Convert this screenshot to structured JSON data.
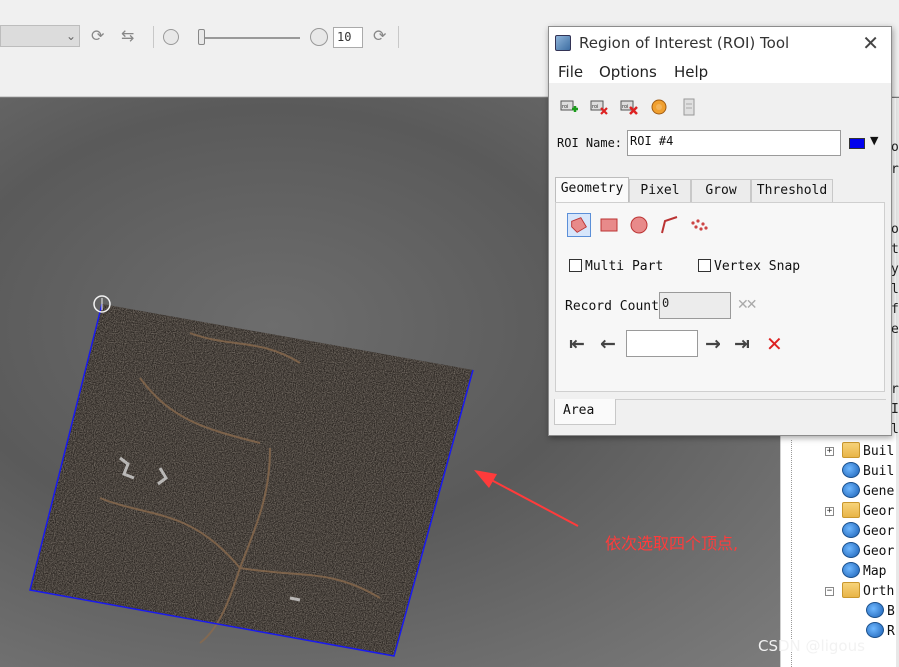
{
  "toolbar": {
    "slider_value": "10",
    "icons": [
      "refresh-icon",
      "stretch-icon",
      "brightness-icon",
      "refresh-icon"
    ]
  },
  "dialog": {
    "title": "Region of Interest (ROI) Tool",
    "menu": [
      "File",
      "Options",
      "Help"
    ],
    "tools": [
      "new-roi-icon",
      "delete-roi-icon",
      "delete-all-roi-icon",
      "go-to-roi-icon",
      "info-icon"
    ],
    "roi_name_label": "ROI Name:",
    "roi_name_value": "ROI #4",
    "roi_color": "#0000ee",
    "tabs": [
      "Geometry",
      "Pixel",
      "Grow",
      "Threshold"
    ],
    "active_tab": "Geometry",
    "geometry_tools": [
      "polygon-icon",
      "rectangle-icon",
      "ellipse-icon",
      "polyline-icon",
      "point-icon"
    ],
    "multi_part_label": "Multi Part",
    "vertex_snap_label": "Vertex Snap",
    "record_count_label": "Record Count",
    "record_count_value": "0",
    "bottom_tab": "Area"
  },
  "tree": {
    "items": [
      {
        "label": "Buil",
        "icon": "folder",
        "expander": "+"
      },
      {
        "label": "Buil",
        "icon": "tool"
      },
      {
        "label": "Gene",
        "icon": "tool"
      },
      {
        "label": "Geor",
        "icon": "folder",
        "expander": "+"
      },
      {
        "label": "Geor",
        "icon": "tool"
      },
      {
        "label": "Geor",
        "icon": "tool"
      },
      {
        "label": "Map",
        "icon": "tool"
      },
      {
        "label": "Orth",
        "icon": "folder",
        "expander": "−"
      },
      {
        "label": "B",
        "icon": "tool"
      },
      {
        "label": "R",
        "icon": "tool"
      }
    ],
    "edge_chars": [
      "o",
      "r",
      "o",
      "t",
      "y",
      "l",
      "f",
      "e",
      "r",
      "I",
      "l"
    ]
  },
  "annotation": {
    "text": "依次选取四个顶点,",
    "color": "#ff3b3b"
  },
  "watermark": "CSDN @ligous"
}
